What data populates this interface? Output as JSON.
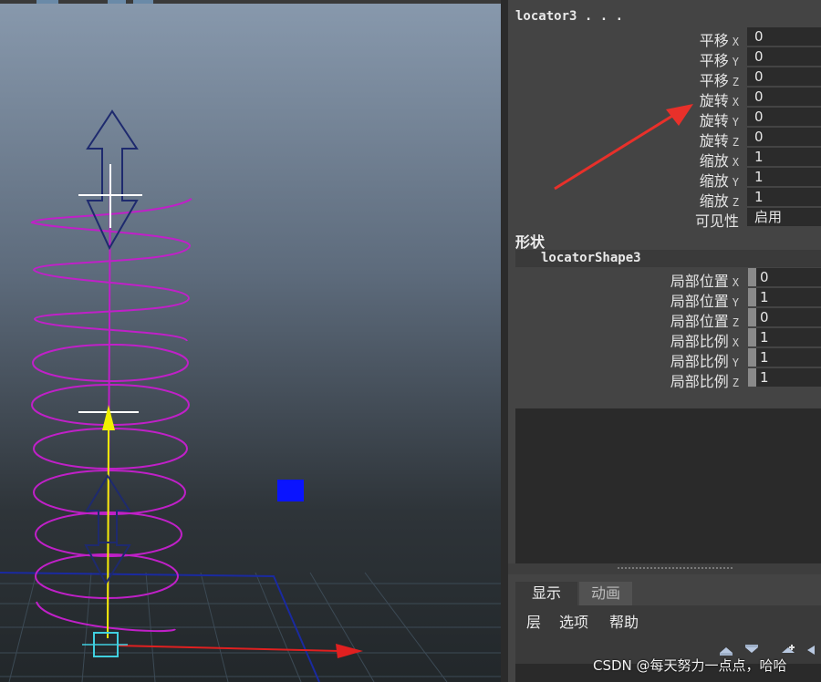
{
  "viewport": {
    "name": "3d-viewport"
  },
  "attribute_editor": {
    "node_name": "locator3 . . .",
    "transform_attrs": [
      {
        "label": "平移",
        "axis": "X",
        "value": "0"
      },
      {
        "label": "平移",
        "axis": "Y",
        "value": "0"
      },
      {
        "label": "平移",
        "axis": "Z",
        "value": "0"
      },
      {
        "label": "旋转",
        "axis": "X",
        "value": "0"
      },
      {
        "label": "旋转",
        "axis": "Y",
        "value": "0"
      },
      {
        "label": "旋转",
        "axis": "Z",
        "value": "0"
      },
      {
        "label": "缩放",
        "axis": "X",
        "value": "1"
      },
      {
        "label": "缩放",
        "axis": "Y",
        "value": "1"
      },
      {
        "label": "缩放",
        "axis": "Z",
        "value": "1"
      }
    ],
    "visibility": {
      "label": "可见性",
      "value": "启用"
    },
    "shape_section": {
      "title": "形状",
      "shape_name": "locatorShape3",
      "attrs": [
        {
          "label": "局部位置",
          "axis": "X",
          "value": "0"
        },
        {
          "label": "局部位置",
          "axis": "Y",
          "value": "1"
        },
        {
          "label": "局部位置",
          "axis": "Z",
          "value": "0"
        },
        {
          "label": "局部比例",
          "axis": "X",
          "value": "1"
        },
        {
          "label": "局部比例",
          "axis": "Y",
          "value": "1"
        },
        {
          "label": "局部比例",
          "axis": "Z",
          "value": "1"
        }
      ]
    }
  },
  "layer_editor": {
    "tabs": [
      {
        "label": "显示",
        "active": true
      },
      {
        "label": "动画",
        "active": false
      }
    ],
    "menu": [
      "层",
      "选项",
      "帮助"
    ]
  },
  "watermark": "CSDN @每天努力一点点，哈哈",
  "colors": {
    "helix": "#c020c8",
    "arrow_outline": "#1e2a6e",
    "annotation_arrow": "#e8302a",
    "x_axis": "#e02020",
    "y_axis": "#f0f000",
    "blue_square": "#0a14ff",
    "grid_boundary": "#1a2aa0"
  }
}
